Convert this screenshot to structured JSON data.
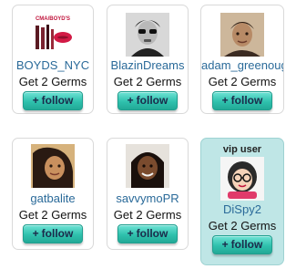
{
  "users": [
    {
      "name": "BOYDS_NYC",
      "germs": "Get 2 Germs",
      "button": "follow",
      "avatar_caption": "CMA/BOYD'S"
    },
    {
      "name": "BlazinDreams",
      "germs": "Get 2 Germs",
      "button": "follow"
    },
    {
      "name": "adam_greenoug",
      "germs": "Get 2 Germs",
      "button": "follow"
    },
    {
      "name": "gatbalite",
      "germs": "Get 2 Germs",
      "button": "follow"
    },
    {
      "name": "savvymoPR",
      "germs": "Get 2 Germs",
      "button": "follow"
    },
    {
      "name": "DiSpy2",
      "germs": "Get 2 Germs",
      "button": "follow",
      "badge": "vip user"
    }
  ],
  "button_icon": "+",
  "colors": {
    "username": "#2a6a99",
    "button_green": "#2fc1ad",
    "vip_background": "#bfe6e6"
  }
}
